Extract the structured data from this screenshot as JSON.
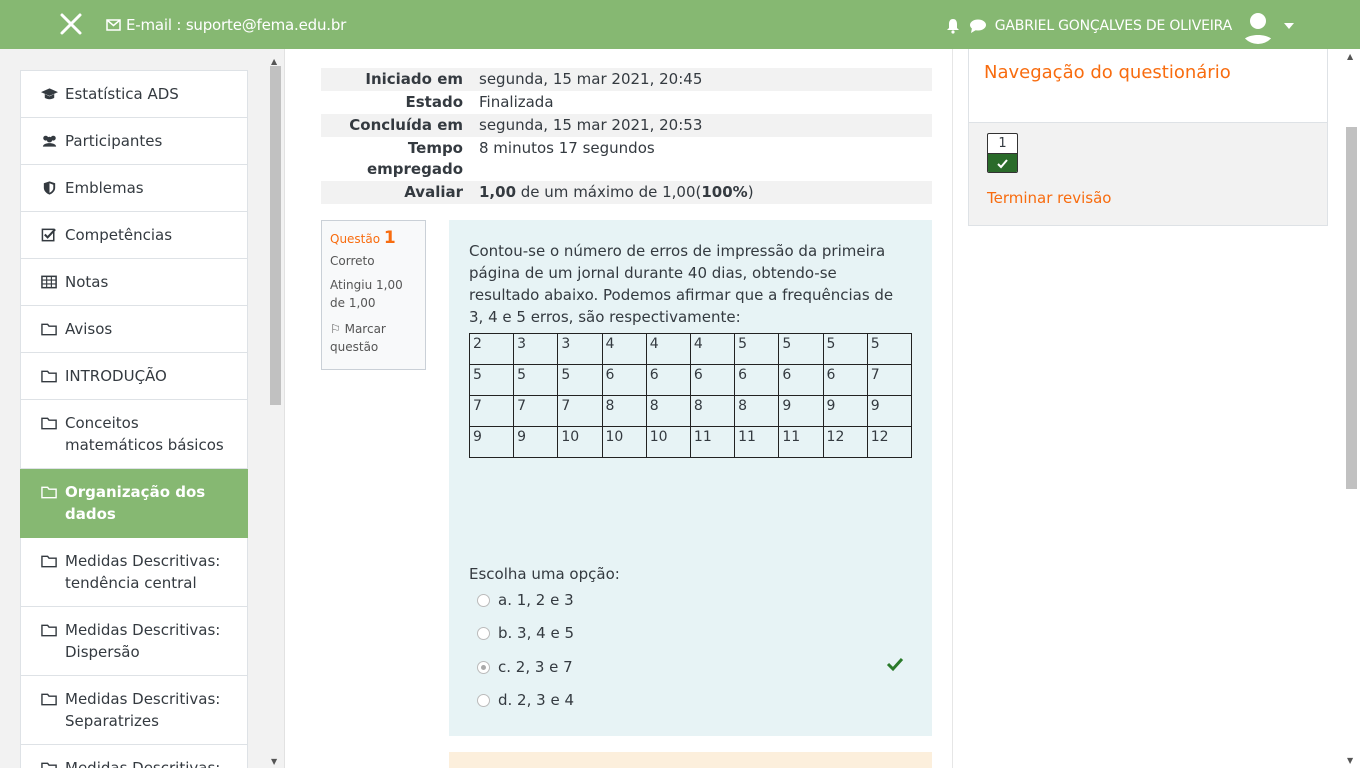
{
  "topbar": {
    "email": "E-mail : suporte@fema.edu.br",
    "username": "GABRIEL GONÇALVES DE OLIVEIRA",
    "color": "#86b872"
  },
  "drawer": {
    "items": [
      {
        "label": "Estatística ADS",
        "icon": "graduation-cap-icon"
      },
      {
        "label": "Participantes",
        "icon": "users-icon"
      },
      {
        "label": "Emblemas",
        "icon": "shield-icon"
      },
      {
        "label": "Competências",
        "icon": "checkbox-icon"
      },
      {
        "label": "Notas",
        "icon": "table-icon"
      },
      {
        "label": "Avisos",
        "icon": "folder-icon"
      },
      {
        "label": "INTRODUÇÃO",
        "icon": "folder-icon"
      },
      {
        "label": "Conceitos matemáticos básicos",
        "icon": "folder-icon"
      },
      {
        "label": "Organização dos dados",
        "icon": "folder-icon",
        "active": true
      },
      {
        "label": "Medidas Descritivas: tendência central",
        "icon": "folder-icon"
      },
      {
        "label": "Medidas Descritivas: Dispersão",
        "icon": "folder-icon"
      },
      {
        "label": "Medidas Descritivas: Separatrizes",
        "icon": "folder-icon"
      },
      {
        "label": "Medidas Descritivas:",
        "icon": "folder-icon"
      }
    ]
  },
  "summary": {
    "started_label": "Iniciado em",
    "started": "segunda, 15 mar 2021, 20:45",
    "state_label": "Estado",
    "state": "Finalizada",
    "completed_label": "Concluída em",
    "completed": "segunda, 15 mar 2021, 20:53",
    "time_label_1": "Tempo",
    "time_label_2": "empregado",
    "time": "8 minutos 17 segundos",
    "grade_label": "Avaliar",
    "grade_value": "1,00",
    "grade_mid": " de um máximo de 1,00(",
    "grade_pct": "100%",
    "grade_end": ")"
  },
  "question_info": {
    "label": "Questão",
    "number": "1",
    "status": "Correto",
    "score": "Atingiu 1,00 de 1,00",
    "flag": "Marcar questão"
  },
  "question": {
    "text": "Contou-se o número de erros de impressão da primeira página de um jornal durante 40 dias, obtendo-se resultado abaixo. Podemos afirmar que a frequências de 3, 4 e  5 erros, são respectivamente:",
    "table": [
      [
        "2",
        "3",
        "3",
        "4",
        "4",
        "4",
        "5",
        "5",
        "5",
        "5"
      ],
      [
        "5",
        "5",
        "5",
        "6",
        "6",
        "6",
        "6",
        "6",
        "6",
        "7"
      ],
      [
        "7",
        "7",
        "7",
        "8",
        "8",
        "8",
        "8",
        "9",
        "9",
        "9"
      ],
      [
        "9",
        "9",
        "10",
        "10",
        "10",
        "11",
        "11",
        "11",
        "12",
        "12"
      ]
    ],
    "prompt": "Escolha uma opção:",
    "options": [
      {
        "label": "a. 1, 2 e 3",
        "checked": false
      },
      {
        "label": "b. 3, 4 e 5",
        "checked": false
      },
      {
        "label": "c.  2, 3 e 7",
        "checked": true
      },
      {
        "label": "d. 2, 3 e 4",
        "checked": false
      }
    ]
  },
  "nav_block": {
    "title": "Navegação do questionário",
    "question_button": "1",
    "finish": "Terminar revisão",
    "accent": "#f86c0f"
  }
}
